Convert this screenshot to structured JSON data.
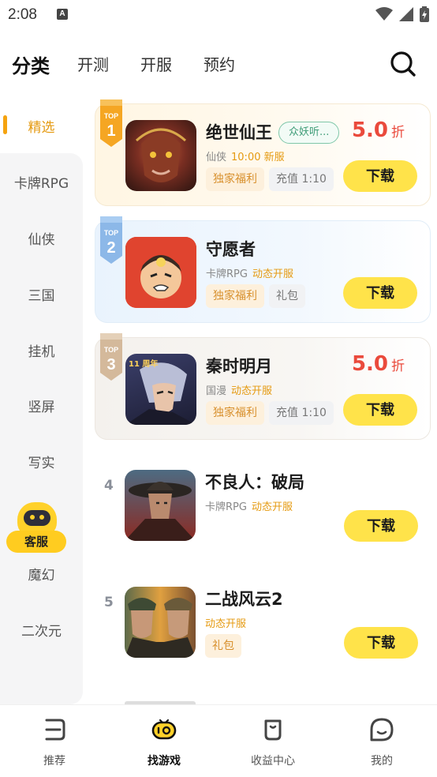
{
  "status_bar": {
    "time": "2:08",
    "notification_letter": "A"
  },
  "top_tabs": [
    {
      "label": "分类",
      "active": true
    },
    {
      "label": "开测",
      "active": false
    },
    {
      "label": "开服",
      "active": false
    },
    {
      "label": "预约",
      "active": false
    }
  ],
  "sidebar": {
    "items": [
      {
        "label": "精选",
        "active": true
      },
      {
        "label": "卡牌RPG"
      },
      {
        "label": "仙侠"
      },
      {
        "label": "三国"
      },
      {
        "label": "挂机"
      },
      {
        "label": "竖屏"
      },
      {
        "label": "写实"
      },
      {
        "label": "魔幻"
      },
      {
        "label": "二次元"
      }
    ],
    "customer_service": "客服"
  },
  "games": [
    {
      "rank": "1",
      "rank_badge": "TOP",
      "name": "绝世仙王",
      "tag": "众妖听...",
      "meta_gray": "仙侠",
      "meta_highlight": [
        "10:00 新服"
      ],
      "chips": [
        {
          "label": "独家福利",
          "style": "orange"
        },
        {
          "label": "充值 1:10",
          "style": "gray"
        }
      ],
      "discount": "5.0",
      "discount_unit": "折",
      "download": "下载"
    },
    {
      "rank": "2",
      "rank_badge": "TOP",
      "name": "守愿者",
      "meta_gray": "卡牌RPG",
      "meta_highlight": [
        "动态开服"
      ],
      "chips": [
        {
          "label": "独家福利",
          "style": "orange"
        },
        {
          "label": "礼包",
          "style": "gray"
        }
      ],
      "download": "下载"
    },
    {
      "rank": "3",
      "rank_badge": "TOP",
      "name": "秦时明月",
      "meta_gray": "国漫",
      "meta_highlight": [
        "动态开服"
      ],
      "chips": [
        {
          "label": "独家福利",
          "style": "orange"
        },
        {
          "label": "充值 1:10",
          "style": "gray"
        }
      ],
      "discount": "5.0",
      "discount_unit": "折",
      "icon_text": "11 周年",
      "download": "下载"
    },
    {
      "rank": "4",
      "name": "不良人：破局",
      "meta_gray": "卡牌RPG",
      "meta_highlight": [
        "动态开服"
      ],
      "chips": [],
      "download": "下载"
    },
    {
      "rank": "5",
      "name": "二战风云2",
      "meta_gray": "",
      "meta_highlight": [
        "动态开服"
      ],
      "chips": [
        {
          "label": "礼包",
          "style": "orange"
        }
      ],
      "download": "下载"
    }
  ],
  "bottom_nav": [
    {
      "label": "推荐",
      "icon": "recommend-icon",
      "active": false
    },
    {
      "label": "找游戏",
      "icon": "gamepad-icon",
      "active": true
    },
    {
      "label": "收益中心",
      "icon": "earnings-icon",
      "active": false
    },
    {
      "label": "我的",
      "icon": "profile-icon",
      "active": false
    }
  ],
  "colors": {
    "accent": "#f5a30f",
    "download_button": "#ffe34a",
    "discount": "#ea4a3c"
  }
}
